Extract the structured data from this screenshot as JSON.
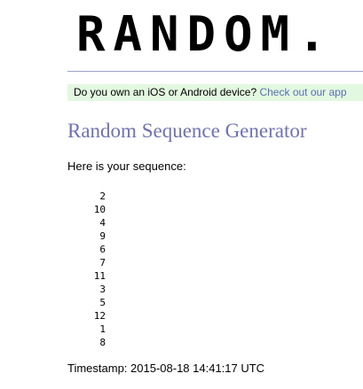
{
  "header": {
    "logo_text": "RANDOM."
  },
  "promo": {
    "text": "Do you own an iOS or Android device?",
    "link_text": "Check out our app"
  },
  "main": {
    "title": "Random Sequence Generator",
    "intro": "Here is your sequence:",
    "sequence": [
      "2",
      "10",
      "4",
      "9",
      "6",
      "7",
      "11",
      "3",
      "5",
      "12",
      "1",
      "8"
    ],
    "timestamp": "Timestamp: 2015-08-18 14:41:17 UTC"
  },
  "colors": {
    "title": "#6f72b3",
    "link": "#5a6fb0",
    "promo_background": "#e3f8e0",
    "divider": "#9aa2c4"
  }
}
